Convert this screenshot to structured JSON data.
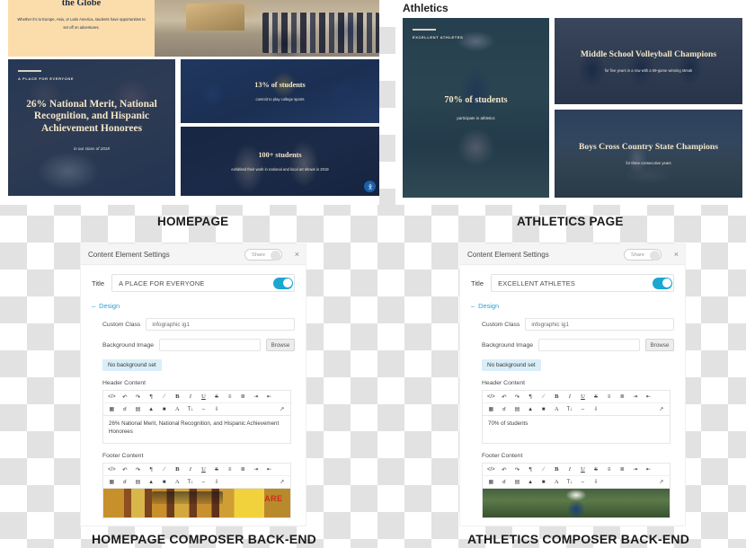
{
  "homepage": {
    "hero": {
      "title": "the Globe",
      "subtitle": "Whether it's to Europe, Asia, or Latin America, students have opportunities to set off on adventures."
    },
    "cards": [
      {
        "eyebrow": "A PLACE FOR EVERYONE",
        "headline": "26% National Merit, National Recognition, and Hispanic Achievement Honorees",
        "subtext": "in our class of 2018"
      },
      {
        "headline": "13% of students",
        "subtext": "commit to play college sports"
      },
      {
        "headline": "100+ students",
        "subtext": "exhibited their work in national and local art shows in 2019"
      }
    ]
  },
  "athletics": {
    "page_title": "Athletics",
    "cards": [
      {
        "eyebrow": "EXCELLENT ATHLETES",
        "headline": "70% of students",
        "subtext": "participate in athletics"
      },
      {
        "headline": "Middle School Volleyball Champions",
        "subtext": "for five years in a row with a 59-game winning streak"
      },
      {
        "headline": "Boys Cross Country State Champions",
        "subtext": "for three consecutive years"
      }
    ]
  },
  "captions": {
    "homepage": "HOMEPAGE",
    "athletics": "ATHLETICS PAGE",
    "homepage_backend": "HOMEPAGE COMPOSER BACK-END",
    "athletics_backend": "ATHLETICS COMPOSER BACK-END"
  },
  "composer_left": {
    "header_title": "Content Element Settings",
    "share_label": "Share",
    "close_label": "×",
    "title_label": "Title",
    "title_value": "A PLACE FOR EVERYONE",
    "design_label": "Design",
    "design_toggle": "–",
    "custom_class_label": "Custom Class",
    "custom_class_value": "infographic ig1",
    "background_image_label": "Background Image",
    "background_image_value": "",
    "browse_label": "Browse",
    "no_background": "No background set",
    "header_content_label": "Header Content",
    "header_content_value": "26% National Merit, National Recognition, and Hispanic Achievement Honorees",
    "footer_content_label": "Footer Content"
  },
  "composer_right": {
    "header_title": "Content Element Settings",
    "share_label": "Share",
    "close_label": "×",
    "title_label": "Title",
    "title_value": "EXCELLENT ATHLETES",
    "design_label": "Design",
    "design_toggle": "–",
    "custom_class_label": "Custom Class",
    "custom_class_value": "infographic ig1",
    "background_image_label": "Background Image",
    "background_image_value": "",
    "browse_label": "Browse",
    "no_background": "No background set",
    "header_content_label": "Header Content",
    "header_content_value": "70% of students",
    "footer_content_label": "Footer Content"
  },
  "toolbar": {
    "row1": [
      "</>",
      "↶",
      "↷",
      "¶",
      "∕",
      "B",
      "I",
      "U",
      "S",
      "≡",
      "≣",
      "⤑",
      "⤐"
    ],
    "row2": [
      "❑",
      "✂",
      "⎙",
      "A",
      "■",
      "A",
      "T↓",
      "–",
      "↓",
      "⤡"
    ],
    "icon_names": [
      "code-icon",
      "undo-icon",
      "redo-icon",
      "paragraph-icon",
      "format-clear-icon",
      "bold-icon",
      "italic-icon",
      "underline-icon",
      "strikethrough-icon",
      "unordered-list-icon",
      "ordered-list-icon",
      "indent-icon",
      "outdent-icon",
      "image-icon",
      "link-icon",
      "table-icon",
      "text-color-icon",
      "highlight-icon",
      "font-family-icon",
      "font-size-icon",
      "horizontal-rule-icon",
      "align-icon",
      "fullscreen-icon"
    ]
  },
  "colors": {
    "accent_teal": "#1ba7d0",
    "badge_blue": "#d9eef8",
    "hero_cream": "#fbdcab",
    "headline_gold": "#f3e6c8",
    "overlay_navy": "#1c3052"
  }
}
